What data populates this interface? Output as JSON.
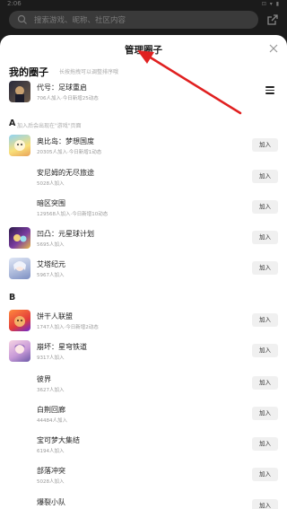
{
  "status": {
    "time": "2:06",
    "sys": "⊡ ▾ ▮"
  },
  "search": {
    "placeholder": "搜索游戏、昵称、社区内容"
  },
  "sheet": {
    "title": "管理圈子",
    "close": "×"
  },
  "my_circles": {
    "title": "我的圈子",
    "hint": "长按拖拽可以调整排序哦",
    "items": [
      {
        "name": "代号：足球重启",
        "meta": "706人加入·今日新增25动态",
        "icon": "soccer-game-icon"
      }
    ]
  },
  "groups": [
    {
      "letter": "A",
      "hint": "加入后会出现在\"游戏\"页面",
      "items": [
        {
          "name": "奥比岛：梦想国度",
          "meta": "20305人加入·今日新增1动态",
          "icon": "game-icon",
          "button": "加入"
        },
        {
          "name": "安尼姆的无尽旅途",
          "meta": "5028人加入",
          "icon": "",
          "button": "加入"
        },
        {
          "name": "暗区突围",
          "meta": "129568人加入·今日新增10动态",
          "icon": "",
          "button": "加入"
        },
        {
          "name": "凹凸：元星球计划",
          "meta": "5695人加入",
          "icon": "game-icon",
          "button": "加入"
        },
        {
          "name": "艾塔纪元",
          "meta": "5967人加入",
          "icon": "game-icon",
          "button": "加入"
        }
      ]
    },
    {
      "letter": "B",
      "hint": "",
      "items": [
        {
          "name": "饼干人联盟",
          "meta": "1747人加入·今日新增2动态",
          "icon": "game-icon",
          "button": "加入"
        },
        {
          "name": "崩坏：星穹铁道",
          "meta": "9317人加入",
          "icon": "game-icon",
          "button": "加入"
        },
        {
          "name": "彼界",
          "meta": "3627人加入",
          "icon": "",
          "button": "加入"
        },
        {
          "name": "白荆回廊",
          "meta": "44484人加入",
          "icon": "",
          "button": "加入"
        },
        {
          "name": "宝可梦大集结",
          "meta": "6194人加入",
          "icon": "",
          "button": "加入"
        },
        {
          "name": "部落冲突",
          "meta": "5028人加入",
          "icon": "",
          "button": "加入"
        },
        {
          "name": "爆裂小队",
          "meta": "",
          "icon": "",
          "button": "加入"
        }
      ]
    }
  ],
  "colors": {
    "arrow": "#e02020",
    "join_bg": "#f0f0f0"
  }
}
